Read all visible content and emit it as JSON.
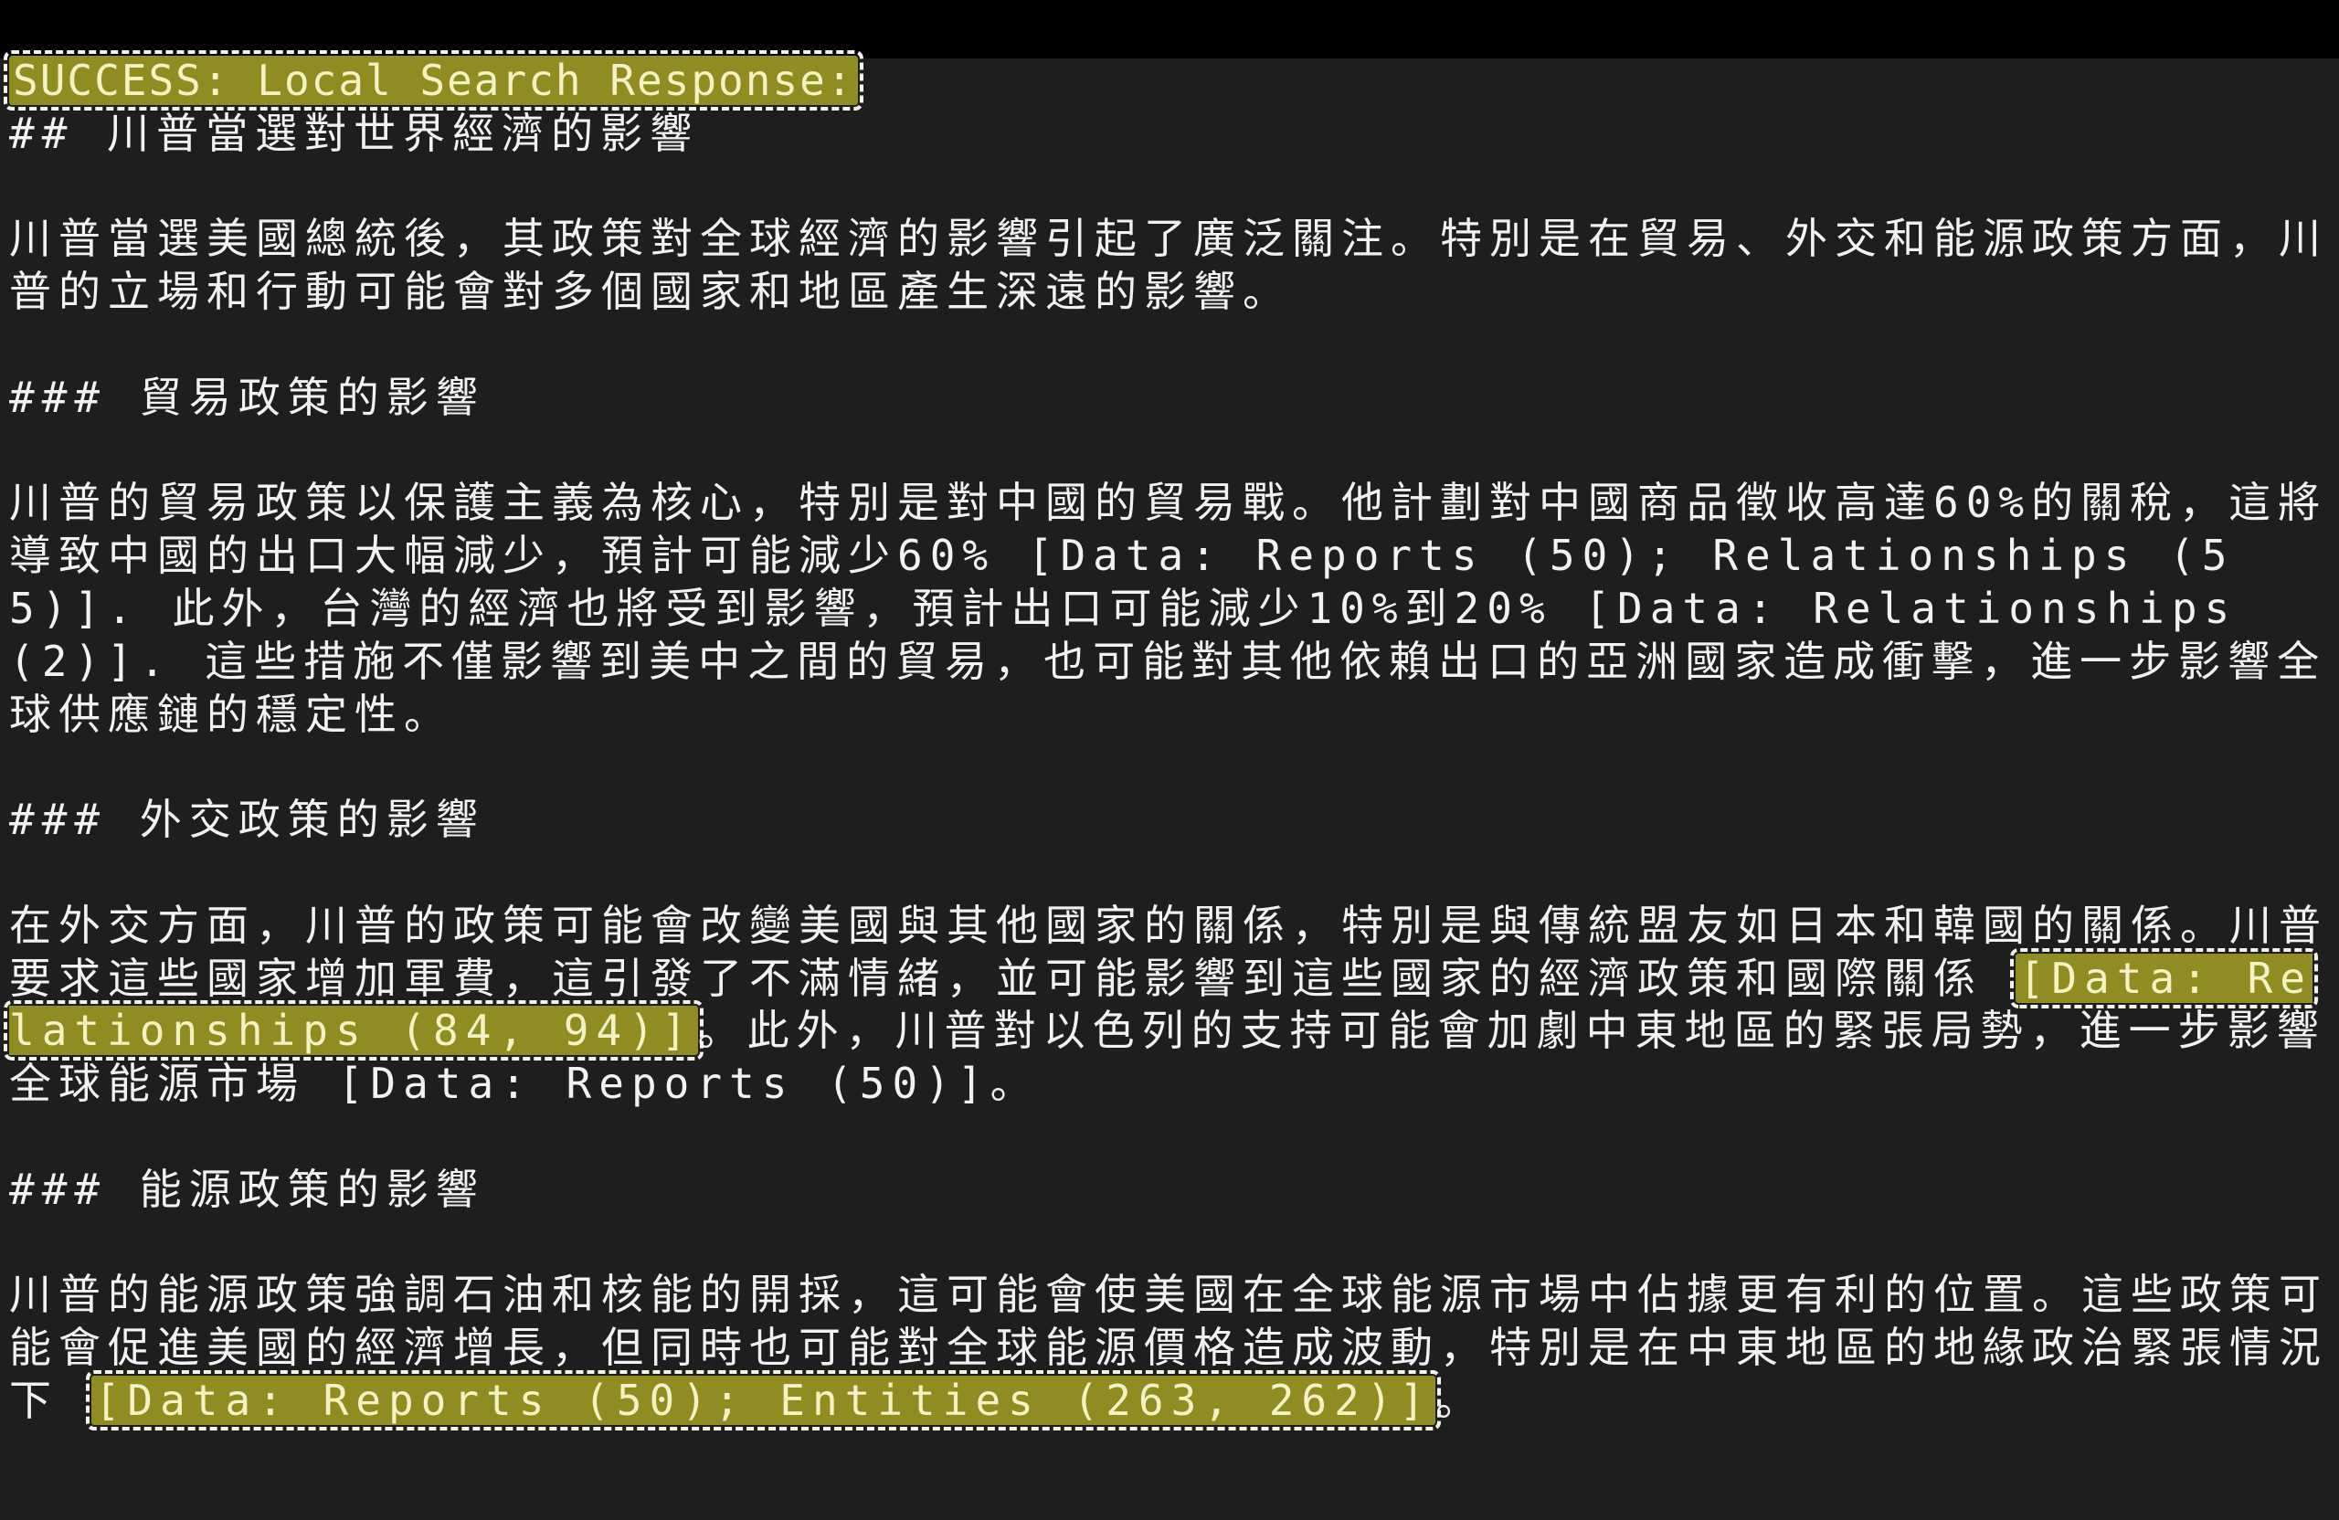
{
  "terminal": {
    "status": "SUCCESS: Local Search Response:",
    "title": "## 川普當選對世界經濟的影響",
    "intro": "川普當選美國總統後，其政策對全球經濟的影響引起了廣泛關注。特別是在貿易、外交和能源政策方面，川普的立場和行動可能會對多個國家和地區產生深遠的影響。",
    "trade": {
      "heading": "### 貿易政策的影響",
      "text": "川普的貿易政策以保護主義為核心，特別是對中國的貿易戰。他計劃對中國商品徵收高達60%的關稅，這將導致中國的出口大幅減少，預計可能減少60% [Data: Reports (50); Relationships (55)]. 此外，台灣的經濟也將受到影響，預計出口可能減少10%到20% [Data: Relationships (2)]. 這些措施不僅影響到美中之間的貿易，也可能對其他依賴出口的亞洲國家造成衝擊，進一步影響全球供應鏈的穩定性。"
    },
    "diplomacy": {
      "heading": "### 外交政策的影響",
      "text_before": "在外交方面，川普的政策可能會改變美國與其他國家的關係，特別是與傳統盟友如日本和韓國的關係。川普要求這些國家增加軍費，這引發了不滿情緒，並可能影響到這些國家的經濟政策和國際關係 ",
      "highlight": "[Data: Relationships (84, 94)]",
      "text_after": "。此外，川普對以色列的支持可能會加劇中東地區的緊張局勢，進一步影響全球能源市場 [Data: Reports (50)]。"
    },
    "energy": {
      "heading": "### 能源政策的影響",
      "text_before": "川普的能源政策強調石油和核能的開採，這可能會使美國在全球能源市場中佔據更有利的位置。這些政策可能會促進美國的經濟增長，但同時也可能對全球能源價格造成波動，特別是在中東地區的地緣政治緊張情況下 ",
      "highlight": "[Data: Reports (50); Entities (263, 262)]",
      "text_after": "。"
    },
    "colors": {
      "background": "#1e1e1e",
      "text": "#f2f2f2",
      "highlight": "#8f8c22"
    }
  }
}
